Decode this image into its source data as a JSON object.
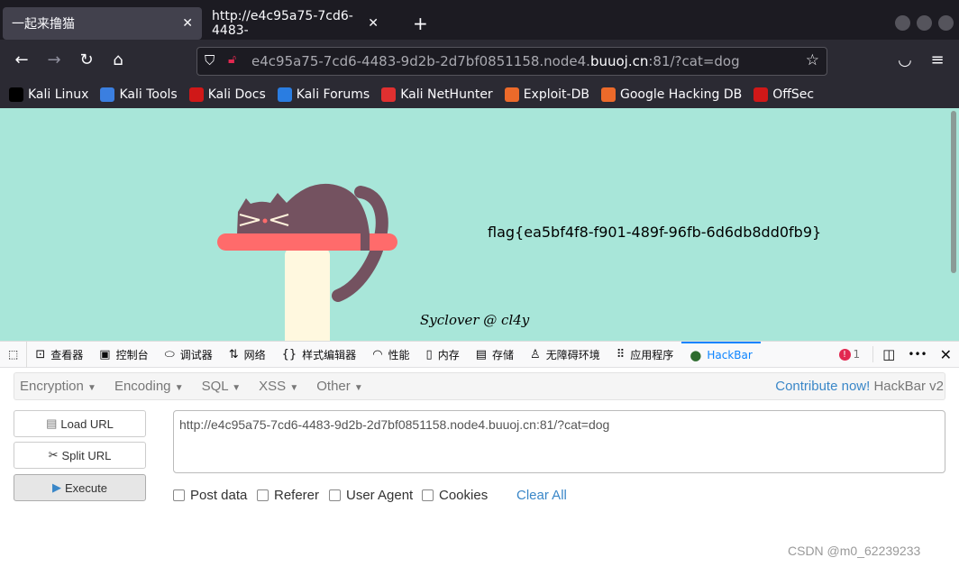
{
  "browser": {
    "tabs": [
      {
        "label": "一起来撸猫",
        "active": true
      },
      {
        "label": "http://e4c95a75-7cd6-4483-"
      }
    ],
    "url": {
      "prefix": "e4c95a75-7cd6-4483-9d2b-2d7bf0851158.node4.",
      "domain": "buuoj.cn",
      "suffix": ":81/?cat=dog"
    },
    "bookmarks": [
      {
        "label": "Kali Linux",
        "icon": "kali-dragon-icon",
        "color": "#000000"
      },
      {
        "label": "Kali Tools",
        "icon": "kali-tools-icon",
        "color": "#3b7fe0"
      },
      {
        "label": "Kali Docs",
        "icon": "kali-docs-icon",
        "color": "#d01818"
      },
      {
        "label": "Kali Forums",
        "icon": "kali-forums-icon",
        "color": "#2a7de1"
      },
      {
        "label": "Kali NetHunter",
        "icon": "nethunter-icon",
        "color": "#e03030"
      },
      {
        "label": "Exploit-DB",
        "icon": "exploit-db-icon",
        "color": "#ec6a2a"
      },
      {
        "label": "Google Hacking DB",
        "icon": "ghdb-icon",
        "color": "#ec6a2a"
      },
      {
        "label": "OffSec",
        "icon": "offsec-icon",
        "color": "#d01818"
      }
    ]
  },
  "page": {
    "flag": "flag{ea5bf4f8-f901-489f-96fb-6d6db8dd0fb9}",
    "signature": "Syclover @ cl4y",
    "background": "#a8e6d9"
  },
  "devtools": {
    "tabs": [
      {
        "label": "查看器",
        "icon": "inspector-icon"
      },
      {
        "label": "控制台",
        "icon": "console-icon"
      },
      {
        "label": "调试器",
        "icon": "debugger-icon"
      },
      {
        "label": "网络",
        "icon": "network-icon"
      },
      {
        "label": "样式编辑器",
        "icon": "style-editor-icon"
      },
      {
        "label": "性能",
        "icon": "performance-icon"
      },
      {
        "label": "内存",
        "icon": "memory-icon"
      },
      {
        "label": "存储",
        "icon": "storage-icon"
      },
      {
        "label": "无障碍环境",
        "icon": "accessibility-icon"
      },
      {
        "label": "应用程序",
        "icon": "application-icon"
      },
      {
        "label": "HackBar",
        "icon": "hackbar-icon",
        "active": true
      }
    ],
    "error_count": "1"
  },
  "hackbar": {
    "menus": [
      "Encryption",
      "Encoding",
      "SQL",
      "XSS",
      "Other"
    ],
    "contribute": "Contribute now!",
    "version": "HackBar v2",
    "buttons": {
      "load": "Load URL",
      "split": "Split URL",
      "execute": "Execute"
    },
    "url_value": "http://e4c95a75-7cd6-4483-9d2b-2d7bf0851158.node4.buuoj.cn:81/?cat=dog",
    "options": [
      {
        "label": "Post data",
        "checked": false
      },
      {
        "label": "Referer",
        "checked": false
      },
      {
        "label": "User Agent",
        "checked": false
      },
      {
        "label": "Cookies",
        "checked": false
      }
    ],
    "clear_all": "Clear All"
  },
  "watermark": "CSDN @m0_62239233"
}
